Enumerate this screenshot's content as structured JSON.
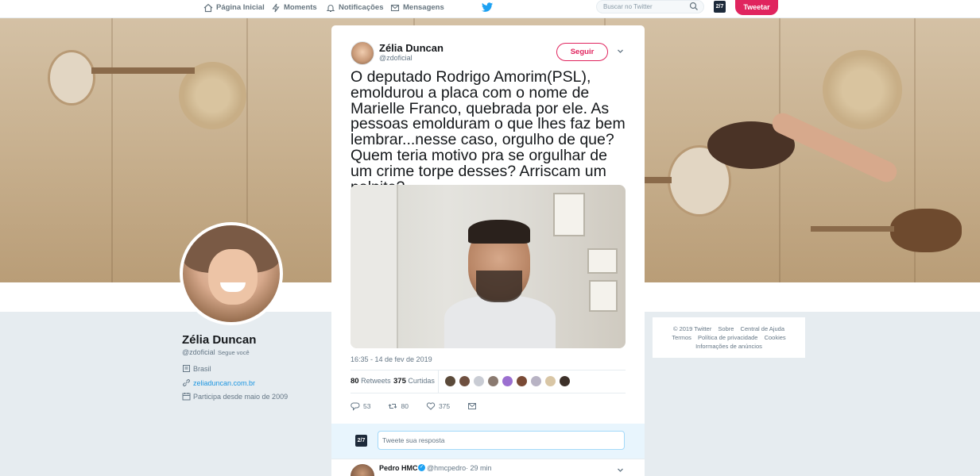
{
  "nav": {
    "home": "Página Inicial",
    "moments": "Moments",
    "notifications": "Notificações",
    "messages": "Mensagens",
    "search_placeholder": "Buscar no Twitter",
    "user_avatar": "2/7",
    "tweet_button": "Tweetar"
  },
  "overlay": {
    "close": "✕"
  },
  "profile": {
    "name": "Zélia Duncan",
    "handle": "@zdoficial",
    "follows_you": "Segue você",
    "location": "Brasil",
    "website": "zeliaduncan.com.br",
    "joined": "Participa desde maio de 2009"
  },
  "footer": {
    "copyright": "© 2019 Twitter",
    "about": "Sobre",
    "help": "Central de Ajuda",
    "terms": "Termos",
    "privacy": "Política de privacidade",
    "cookies": "Cookies",
    "ads": "Informações de anúncios"
  },
  "tweet": {
    "author_name": "Zélia Duncan",
    "author_handle": "@zdoficial",
    "follow_label": "Seguir",
    "text": "O deputado Rodrigo Amorim(PSL), emoldurou a placa com o nome de Marielle Franco, quebrada por ele. As pessoas emolduram o que lhes faz bem lembrar...nesse caso, orgulho de que? Quem teria motivo pra se orgulhar de um crime torpe desses? Arriscam um palpite?",
    "timestamp": "16:35 - 14 de fev de 2019",
    "retweets_count": "80",
    "retweets_label": "Retweets",
    "likes_count": "375",
    "likes_label": "Curtidas",
    "reply_count": "53",
    "retweet_action_count": "80",
    "like_action_count": "375"
  },
  "reply_box": {
    "avatar": "2/7",
    "placeholder": "Tweete sua resposta"
  },
  "reply": {
    "name": "Pedro HMC",
    "handle": "@hmcpedro",
    "time": "· 29 min"
  },
  "colors": {
    "brand": "#1da1f2",
    "accent": "#e0245e"
  }
}
